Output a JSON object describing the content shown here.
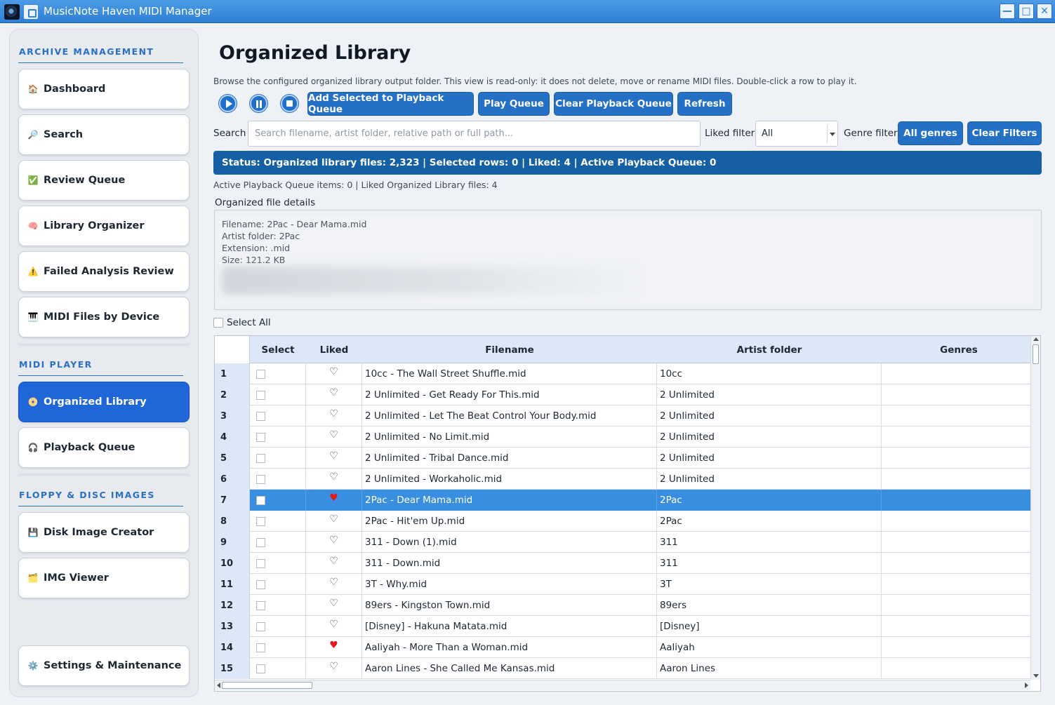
{
  "window": {
    "title": "MusicNote Haven MIDI Manager",
    "controls": {
      "minimize": "—",
      "maximize": "□",
      "close": "✕"
    }
  },
  "sidebar": {
    "sections": [
      {
        "title": "ARCHIVE MANAGEMENT"
      },
      {
        "title": "MIDI PLAYER"
      },
      {
        "title": "FLOPPY & DISC IMAGES"
      }
    ],
    "items": [
      {
        "icon": "🏠",
        "icon_name": "home-icon",
        "label": "Dashboard"
      },
      {
        "icon": "🔎",
        "icon_name": "magnifier-icon",
        "label": "Search"
      },
      {
        "icon": "✅",
        "icon_name": "check-icon",
        "label": "Review Queue"
      },
      {
        "icon": "🧠",
        "icon_name": "brain-icon",
        "label": "Library Organizer"
      },
      {
        "icon": "⚠️",
        "icon_name": "warning-icon",
        "label": "Failed Analysis Review"
      },
      {
        "icon": "🎹",
        "icon_name": "keyboard-icon",
        "label": "MIDI Files by Device"
      },
      {
        "icon": "📀",
        "icon_name": "disc-icon",
        "label": "Organized Library",
        "active": true
      },
      {
        "icon": "🎧",
        "icon_name": "headphones-icon",
        "label": "Playback Queue"
      },
      {
        "icon": "💾",
        "icon_name": "floppy-icon",
        "label": "Disk Image Creator"
      },
      {
        "icon": "🗂️",
        "icon_name": "folder-icon",
        "label": "IMG Viewer"
      },
      {
        "icon": "⚙️",
        "icon_name": "gear-icon",
        "label": "Settings & Maintenance"
      }
    ]
  },
  "main": {
    "title": "Organized Library",
    "description": "Browse the configured organized library output folder. This view is read-only: it does not delete, move or rename MIDI files. Double-click a row to play it.",
    "toolbar": {
      "add_selected": "Add Selected to Playback Queue",
      "play_queue": "Play Queue",
      "clear_queue": "Clear Playback Queue",
      "refresh": "Refresh"
    },
    "filters": {
      "search_label": "Search",
      "search_placeholder": "Search filename, artist folder, relative path or full path...",
      "search_value": "",
      "liked_label": "Liked filter",
      "liked_value": "All",
      "genre_label": "Genre filter",
      "all_genres": "All genres",
      "clear_filters": "Clear Filters"
    },
    "status": "Status: Organized library files: 2,323 | Selected rows: 0 | Liked: 4 | Active Playback Queue: 0",
    "subline": "Active Playback Queue items: 0 | Liked Organized Library files: 4",
    "details": {
      "title": "Organized file details",
      "filename": "Filename: 2Pac - Dear Mama.mid",
      "artist": "Artist folder: 2Pac",
      "extension": "Extension: .mid",
      "size": "Size: 121.2 KB"
    },
    "select_all": "Select All",
    "table": {
      "columns": [
        "Select",
        "Liked",
        "Filename",
        "Artist folder",
        "Genres"
      ],
      "rows": [
        {
          "n": "1",
          "liked": false,
          "filename": "10cc - The Wall Street Shuffle.mid",
          "artist": "10cc",
          "genres": ""
        },
        {
          "n": "2",
          "liked": false,
          "filename": "2 Unlimited - Get Ready For This.mid",
          "artist": "2 Unlimited",
          "genres": ""
        },
        {
          "n": "3",
          "liked": false,
          "filename": "2 Unlimited - Let The Beat Control Your Body.mid",
          "artist": "2 Unlimited",
          "genres": ""
        },
        {
          "n": "4",
          "liked": false,
          "filename": "2 Unlimited - No Limit.mid",
          "artist": "2 Unlimited",
          "genres": ""
        },
        {
          "n": "5",
          "liked": false,
          "filename": "2 Unlimited - Tribal Dance.mid",
          "artist": "2 Unlimited",
          "genres": ""
        },
        {
          "n": "6",
          "liked": false,
          "filename": "2 Unlimited - Workaholic.mid",
          "artist": "2 Unlimited",
          "genres": ""
        },
        {
          "n": "7",
          "liked": true,
          "filename": "2Pac - Dear Mama.mid",
          "artist": "2Pac",
          "genres": "",
          "selected": true
        },
        {
          "n": "8",
          "liked": false,
          "filename": "2Pac - Hit'em Up.mid",
          "artist": "2Pac",
          "genres": ""
        },
        {
          "n": "9",
          "liked": false,
          "filename": "311 - Down (1).mid",
          "artist": "311",
          "genres": ""
        },
        {
          "n": "10",
          "liked": false,
          "filename": "311 - Down.mid",
          "artist": "311",
          "genres": ""
        },
        {
          "n": "11",
          "liked": false,
          "filename": "3T - Why.mid",
          "artist": "3T",
          "genres": ""
        },
        {
          "n": "12",
          "liked": false,
          "filename": "89ers - Kingston Town.mid",
          "artist": "89ers",
          "genres": ""
        },
        {
          "n": "13",
          "liked": false,
          "filename": "[Disney] - Hakuna Matata.mid",
          "artist": "[Disney]",
          "genres": ""
        },
        {
          "n": "14",
          "liked": true,
          "filename": "Aaliyah - More Than a Woman.mid",
          "artist": "Aaliyah",
          "genres": ""
        },
        {
          "n": "15",
          "liked": false,
          "filename": "Aaron Lines - She Called Me Kansas.mid",
          "artist": "Aaron Lines",
          "genres": ""
        }
      ]
    }
  },
  "colors": {
    "accent": "#2470c4",
    "active_nav": "#1f66d8",
    "status_bar": "#1560a5",
    "selected_row": "#3a8ee0",
    "liked_heart": "#e31a1a",
    "section_title": "#2b6fc7"
  }
}
